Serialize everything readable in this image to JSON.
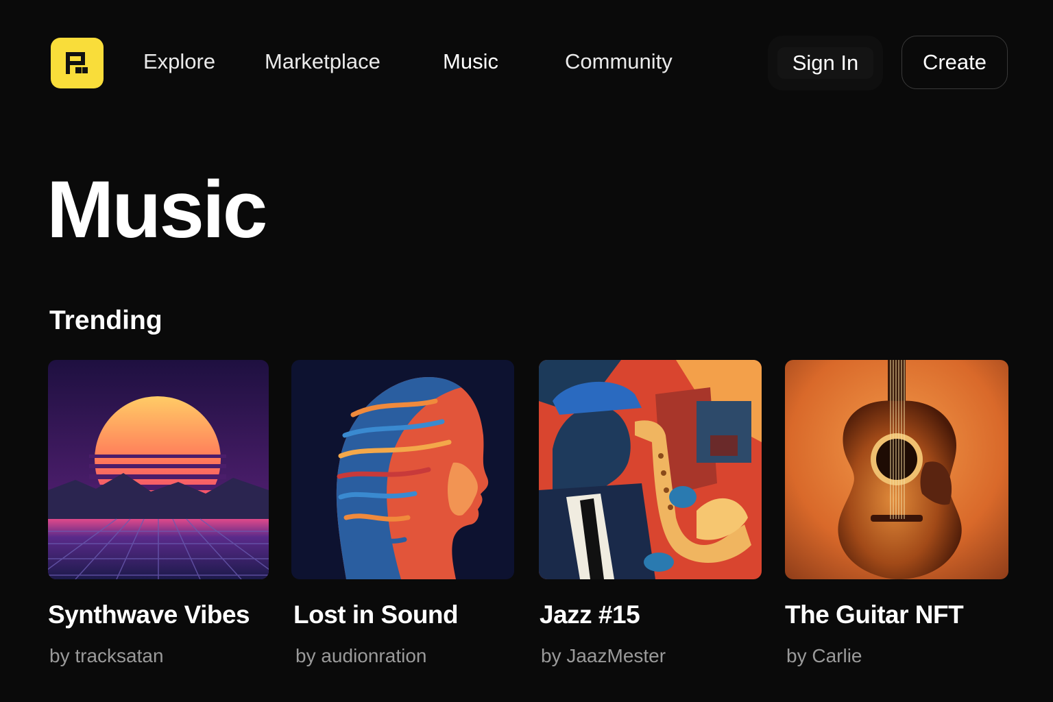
{
  "header": {
    "logo_icon": "flag-logo-icon",
    "nav": [
      {
        "label": "Explore"
      },
      {
        "label": "Marketplace"
      },
      {
        "label": "Music"
      },
      {
        "label": "Community"
      }
    ],
    "sign_in_label": "Sign In",
    "create_label": "Create"
  },
  "main": {
    "title": "Music",
    "section_title": "Trending",
    "cards": [
      {
        "title": "Synthwave Vibes",
        "artist": "by tracksatan",
        "art": "synthwave-sunset-art"
      },
      {
        "title": "Lost in Sound",
        "artist": "by audionration",
        "art": "abstract-head-art"
      },
      {
        "title": "Jazz #15",
        "artist": "by JaazMester",
        "art": "saxophone-player-art"
      },
      {
        "title": "The Guitar NFT",
        "artist": "by Carlie",
        "art": "acoustic-guitar-art"
      }
    ]
  },
  "colors": {
    "background": "#0a0a0a",
    "logo": "#f9dd3a",
    "muted_text": "#9a9a9a"
  }
}
